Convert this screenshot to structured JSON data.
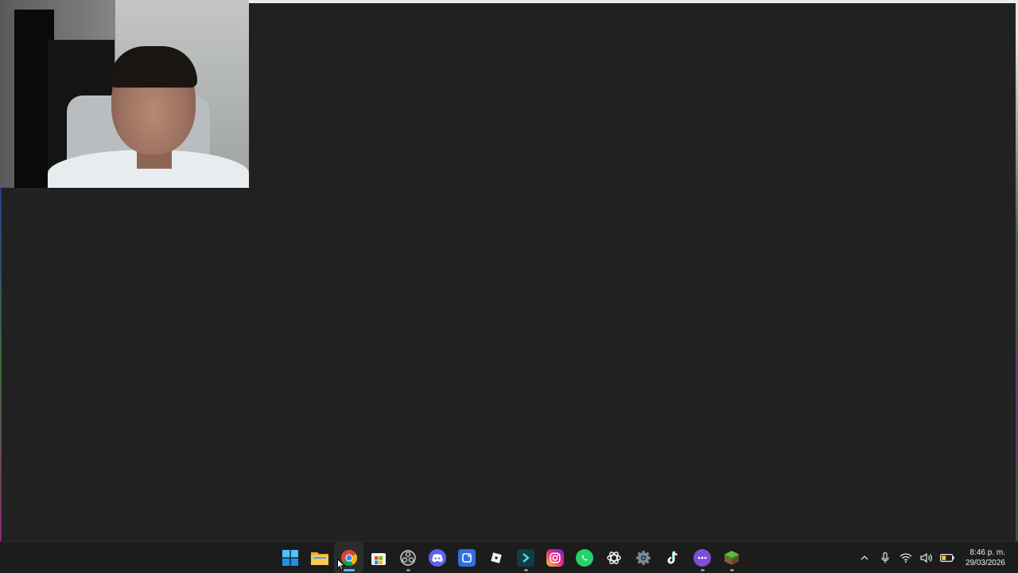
{
  "taskbar": {
    "apps": [
      {
        "name": "start-button",
        "icon": "windows-logo-icon",
        "active": false,
        "running": false
      },
      {
        "name": "file-explorer-button",
        "icon": "folder-icon",
        "active": false,
        "running": false
      },
      {
        "name": "chrome-button",
        "icon": "chrome-icon",
        "active": true,
        "running": true
      },
      {
        "name": "microsoft-store-button",
        "icon": "store-icon",
        "active": false,
        "running": false
      },
      {
        "name": "obs-button",
        "icon": "obs-icon",
        "active": false,
        "running": true
      },
      {
        "name": "discord-button",
        "icon": "discord-icon",
        "active": false,
        "running": false
      },
      {
        "name": "app-square-button",
        "icon": "blue-square-app-icon",
        "active": false,
        "running": false
      },
      {
        "name": "roblox-button",
        "icon": "roblox-icon",
        "active": false,
        "running": false
      },
      {
        "name": "editor-button",
        "icon": "arrow-app-icon",
        "active": false,
        "running": true
      },
      {
        "name": "instagram-button",
        "icon": "instagram-icon",
        "active": false,
        "running": false
      },
      {
        "name": "whatsapp-button",
        "icon": "whatsapp-icon",
        "active": false,
        "running": false
      },
      {
        "name": "chatgpt-button",
        "icon": "chatgpt-icon",
        "active": false,
        "running": false
      },
      {
        "name": "settings-button",
        "icon": "gear-icon",
        "active": false,
        "running": false
      },
      {
        "name": "tiktok-button",
        "icon": "tiktok-icon",
        "active": false,
        "running": false
      },
      {
        "name": "chat-app-button",
        "icon": "chat-bubble-icon",
        "active": false,
        "running": true
      },
      {
        "name": "minecraft-button",
        "icon": "minecraft-cube-icon",
        "active": false,
        "running": true
      }
    ],
    "tray": {
      "chevron": "^",
      "time": "8:46 p. m.",
      "date": "29/03/2026"
    }
  },
  "colors": {
    "desktop_bg": "#212121",
    "taskbar_bg": "#1c1c1c",
    "active_indicator": "#5fb2f2"
  }
}
